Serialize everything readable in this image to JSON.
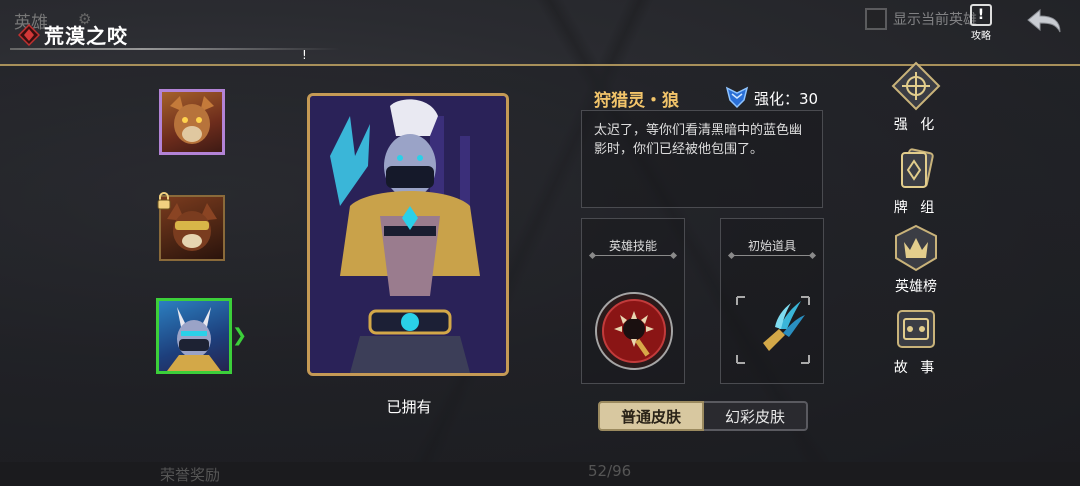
{
  "header": {
    "underlay_title": "英雄",
    "title": "荒漠之咬",
    "show_current_label": "显示当前英雄",
    "guide_label": "攻略"
  },
  "hero_list": [
    {
      "name": "hero-1",
      "locked": false,
      "selected": false
    },
    {
      "name": "hero-2",
      "locked": true,
      "selected": false
    },
    {
      "name": "hero-3",
      "locked": false,
      "selected": true
    }
  ],
  "hero": {
    "name": "狩猎灵・狼",
    "enhance_label": "强化：30",
    "description": "太迟了，等你们看清黑暗中的蓝色幽影时，你们已经被他包围了。",
    "owned_status": "已拥有"
  },
  "cards": {
    "skill_label": "英雄技能",
    "item_label": "初始道具"
  },
  "skins": {
    "normal": "普通皮肤",
    "fancy": "幻彩皮肤"
  },
  "menu": [
    {
      "label": "强 化",
      "icon": "enhance-icon"
    },
    {
      "label": "牌 组",
      "icon": "deck-icon"
    },
    {
      "label": "英雄榜",
      "icon": "ranking-icon"
    },
    {
      "label": "故 事",
      "icon": "story-icon"
    }
  ],
  "footer": {
    "honor_label": "荣誉奖励",
    "progress": "52/96"
  },
  "colors": {
    "accent_gold": "#c59a55",
    "selected_green": "#3ccf3a",
    "name_gold": "#f2c46a",
    "rare_purple": "#b383d6"
  }
}
